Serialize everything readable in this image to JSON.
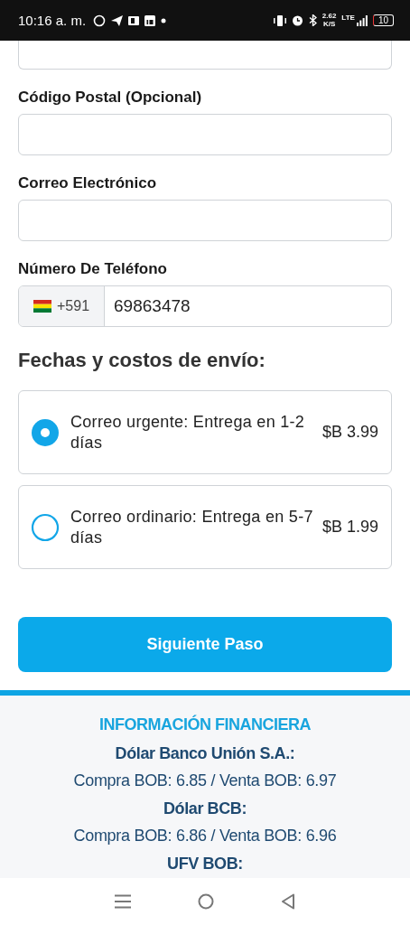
{
  "status_bar": {
    "time": "10:16 a. m.",
    "net_speed": "2.62",
    "net_unit": "K/S",
    "network": "LTE",
    "battery": "10"
  },
  "form": {
    "fields": [
      {
        "kind": "cut"
      },
      {
        "kind": "text",
        "label": "Código Postal (Opcional)"
      },
      {
        "kind": "text",
        "label": "Correo Electrónico"
      },
      {
        "kind": "phone",
        "label": "Número De Teléfono",
        "country_code": "+591",
        "value": "69863478"
      }
    ]
  },
  "shipping": {
    "title": "Fechas y costos de envío:",
    "options": [
      {
        "label": "Correo urgente: Entrega en 1-2 días",
        "price": "$B 3.99",
        "selected": true
      },
      {
        "label": "Correo ordinario: Entrega en 5-7 días",
        "price": "$B 1.99",
        "selected": false
      }
    ]
  },
  "next_button": "Siguiente Paso",
  "finance": {
    "title": "INFORMACIÓN FINANCIERA",
    "lines": [
      {
        "kind": "heading",
        "text": "Dólar Banco Unión S.A.:"
      },
      {
        "kind": "rate",
        "text": "Compra BOB: 6.85 / Venta BOB: 6.97"
      },
      {
        "kind": "heading",
        "text": "Dólar BCB:"
      },
      {
        "kind": "rate",
        "text": "Compra BOB: 6.86 / Venta BOB: 6.96"
      },
      {
        "kind": "heading",
        "text": "UFV BOB:"
      }
    ]
  }
}
